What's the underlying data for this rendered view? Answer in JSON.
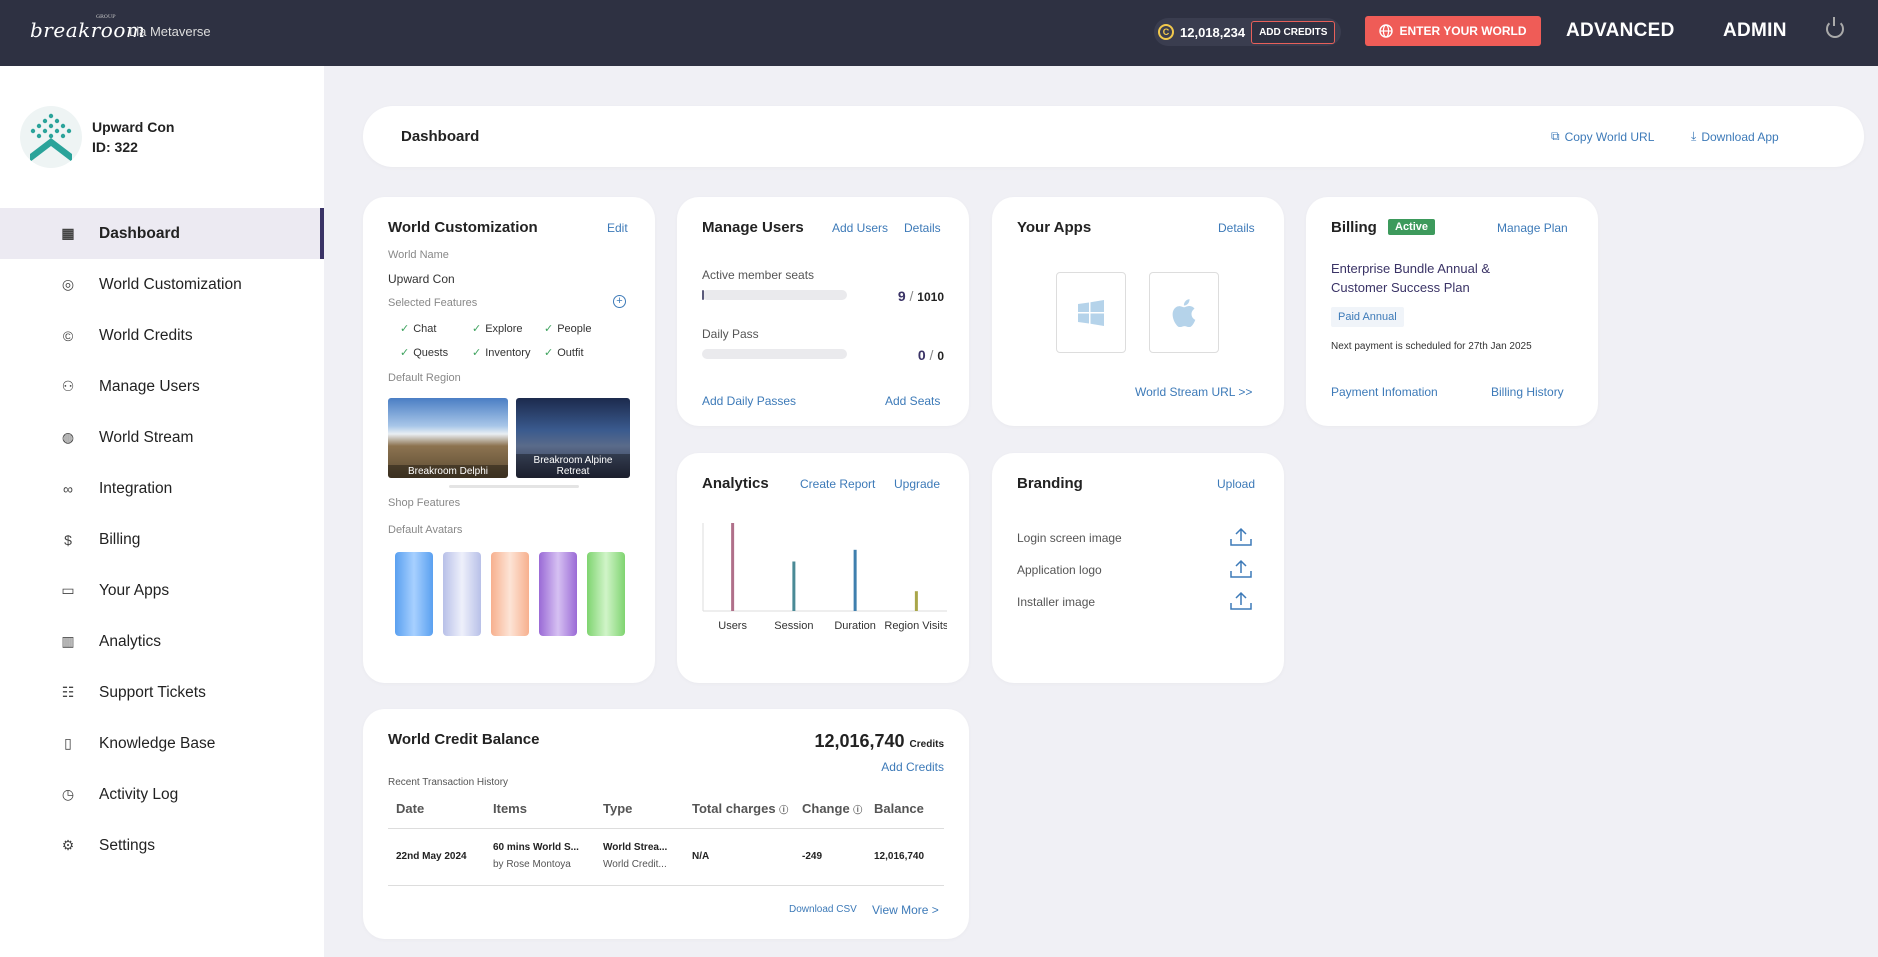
{
  "topbar": {
    "logo": "breakroom",
    "logo_sub": "GROUP",
    "world_name": "Lia Metaverse",
    "credits": "12,018,234",
    "add_credits": "ADD CREDITS",
    "enter_world": "ENTER YOUR WORLD",
    "advanced": "ADVANCED",
    "admin": "ADMIN"
  },
  "profile": {
    "name": "Upward Con",
    "id": "ID: 322"
  },
  "sidebar": {
    "items": [
      {
        "label": "Dashboard",
        "icon": "dashboard-icon"
      },
      {
        "label": "World Customization",
        "icon": "palette-icon"
      },
      {
        "label": "World Credits",
        "icon": "credits-icon"
      },
      {
        "label": "Manage Users",
        "icon": "user-add-icon"
      },
      {
        "label": "World Stream",
        "icon": "globe-icon"
      },
      {
        "label": "Integration",
        "icon": "integration-icon"
      },
      {
        "label": "Billing",
        "icon": "billing-icon"
      },
      {
        "label": "Your Apps",
        "icon": "devices-icon"
      },
      {
        "label": "Analytics",
        "icon": "analytics-icon"
      },
      {
        "label": "Support Tickets",
        "icon": "ticket-icon"
      },
      {
        "label": "Knowledge Base",
        "icon": "book-icon"
      },
      {
        "label": "Activity Log",
        "icon": "history-icon"
      },
      {
        "label": "Settings",
        "icon": "gear-icon"
      }
    ]
  },
  "header": {
    "title": "Dashboard",
    "copy_url": "Copy World URL",
    "download_app": "Download App"
  },
  "world_customization": {
    "title": "World Customization",
    "edit": "Edit",
    "world_name_label": "World Name",
    "world_name": "Upward Con",
    "features_label": "Selected Features",
    "features": [
      "Chat",
      "Explore",
      "People",
      "Quests",
      "Inventory",
      "Outfit"
    ],
    "region_label": "Default Region",
    "regions": [
      "Breakroom Delphi",
      "Breakroom Alpine Retreat"
    ],
    "shop_label": "Shop Features",
    "avatars_label": "Default Avatars"
  },
  "manage_users": {
    "title": "Manage Users",
    "add_users": "Add Users",
    "details": "Details",
    "active_label": "Active member seats",
    "active_used": "9",
    "active_total": "1010",
    "active_fraction": 0.009,
    "daily_label": "Daily Pass",
    "daily_used": "0",
    "daily_total": "0",
    "add_daily": "Add Daily Passes",
    "add_seats": "Add Seats",
    "sep": "/"
  },
  "your_apps": {
    "title": "Your Apps",
    "details": "Details",
    "stream_url": "World Stream URL >>"
  },
  "billing": {
    "title": "Billing",
    "status": "Active",
    "manage": "Manage Plan",
    "plan": "Enterprise Bundle Annual & Customer Success Plan",
    "plan_type": "Paid Annual",
    "next_payment": "Next payment is scheduled for 27th Jan 2025",
    "payment_info": "Payment Infomation",
    "history": "Billing History"
  },
  "analytics": {
    "title": "Analytics",
    "create_report": "Create Report",
    "upgrade": "Upgrade"
  },
  "chart_data": {
    "type": "bar",
    "categories": [
      "Users",
      "Session",
      "Duration",
      "Region Visits"
    ],
    "values": [
      100,
      55,
      68,
      22
    ],
    "colors": [
      "#b0708a",
      "#4a8a96",
      "#3f7fae",
      "#a9a64a"
    ]
  },
  "branding": {
    "title": "Branding",
    "upload": "Upload",
    "items": [
      "Login screen image",
      "Application logo",
      "Installer image"
    ]
  },
  "credit_balance": {
    "title": "World Credit Balance",
    "amount": "12,016,740",
    "unit": "Credits",
    "add_credits": "Add Credits",
    "recent": "Recent Transaction History",
    "columns": [
      "Date",
      "Items",
      "Type",
      "Total charges",
      "Change",
      "Balance"
    ],
    "row": {
      "date": "22nd May 2024",
      "item": "60 mins World S...",
      "item_by": "by Rose Montoya",
      "type": "World Strea...",
      "type_sub": "World Credit...",
      "charges": "N/A",
      "change": "-249",
      "balance": "12,016,740"
    },
    "download_csv": "Download CSV",
    "view_more": "View More >"
  }
}
